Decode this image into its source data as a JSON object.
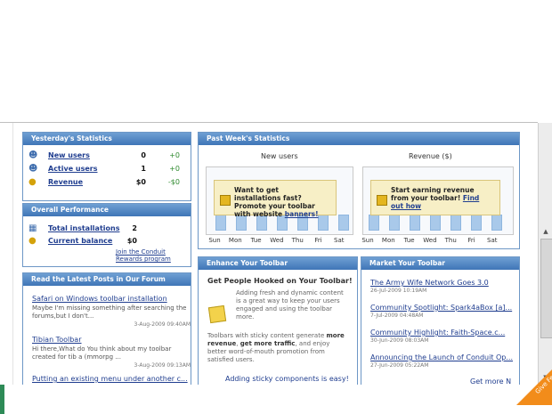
{
  "yesterday": {
    "header": "Yesterday's Statistics",
    "rows": [
      {
        "label": "New users",
        "value": "0",
        "delta": "+0"
      },
      {
        "label": "Active users",
        "value": "1",
        "delta": "+0"
      },
      {
        "label": "Revenue",
        "value": "$0",
        "delta": "-$0"
      }
    ]
  },
  "overall": {
    "header": "Overall Performance",
    "rows": [
      {
        "label": "Total installations",
        "value": "2"
      },
      {
        "label": "Current balance",
        "value": "$0"
      }
    ],
    "link1": "Join the Conduit",
    "link2": "Rewards program"
  },
  "forum": {
    "header": "Read the Latest Posts in Our Forum",
    "posts": [
      {
        "title": "Safari on Windows toolbar installation",
        "body": "Maybe I'm missing something after searching the forums,but I don't...",
        "date": "3-Aug-2009 09:40AM"
      },
      {
        "title": "Tibian Toolbar",
        "body": "Hi there,What do You think about my toolbar created for tib a (mmorpg ...",
        "date": "3-Aug-2009 09:13AM"
      },
      {
        "title": "Putting an existing menu under another c...",
        "body": "",
        "date": ""
      }
    ]
  },
  "past_week": {
    "header": "Past Week's Statistics",
    "new_users_label": "New users",
    "revenue_label": "Revenue ($)",
    "callout1": {
      "text": "Want to get installations fast? Promote your toolbar with website",
      "link": "banners!"
    },
    "callout2": {
      "text": "Start earning revenue from your toolbar!",
      "link": "Find out how"
    },
    "days": [
      "Sun",
      "Mon",
      "Tue",
      "Wed",
      "Thu",
      "Fri",
      "Sat"
    ]
  },
  "chart_data": [
    {
      "type": "bar",
      "title": "New users",
      "categories": [
        "Sun",
        "Mon",
        "Tue",
        "Wed",
        "Thu",
        "Fri",
        "Sat"
      ],
      "values": [
        0,
        0,
        0,
        0,
        0,
        0,
        0
      ]
    },
    {
      "type": "bar",
      "title": "Revenue ($)",
      "categories": [
        "Sun",
        "Mon",
        "Tue",
        "Wed",
        "Thu",
        "Fri",
        "Sat"
      ],
      "values": [
        0,
        0,
        0,
        0,
        0,
        0,
        0
      ]
    }
  ],
  "enhance": {
    "header": "Enhance Your Toolbar",
    "title": "Get People Hooked on Your Toolbar!",
    "text1": "Adding fresh and dynamic content is a great way to keep your users engaged and using the toolbar more.",
    "text2_pre": "Toolbars with sticky content generate ",
    "text2_b1": "more revenue",
    "text2_mid": ", ",
    "text2_b2": "get more traffic",
    "text2_post": ", and enjoy better word-of-mouth promotion from satisfied users.",
    "footer": "Adding sticky components is easy!"
  },
  "market": {
    "header": "Market Your Toolbar",
    "items": [
      {
        "title": "The Army Wife Network Goes 3.0",
        "date": "26-Jul-2009 10:19AM"
      },
      {
        "title": "Community Spotlight: Spark4aBox [a]...",
        "date": "7-Jul-2009 04:48AM"
      },
      {
        "title": "Community Highlight: Faith-Space.c...",
        "date": "30-Jun-2009 08:03AM"
      },
      {
        "title": "Announcing the Launch of Conduit Op...",
        "date": "27-Jun-2009 05:22AM"
      }
    ],
    "more": "Get more N"
  },
  "feedback": {
    "label": "Give Feedback"
  },
  "colors": {
    "header": "#3f75b7",
    "link": "#1f3d8f",
    "positive": "#2f8a2f",
    "callout": "#f7efc6"
  }
}
